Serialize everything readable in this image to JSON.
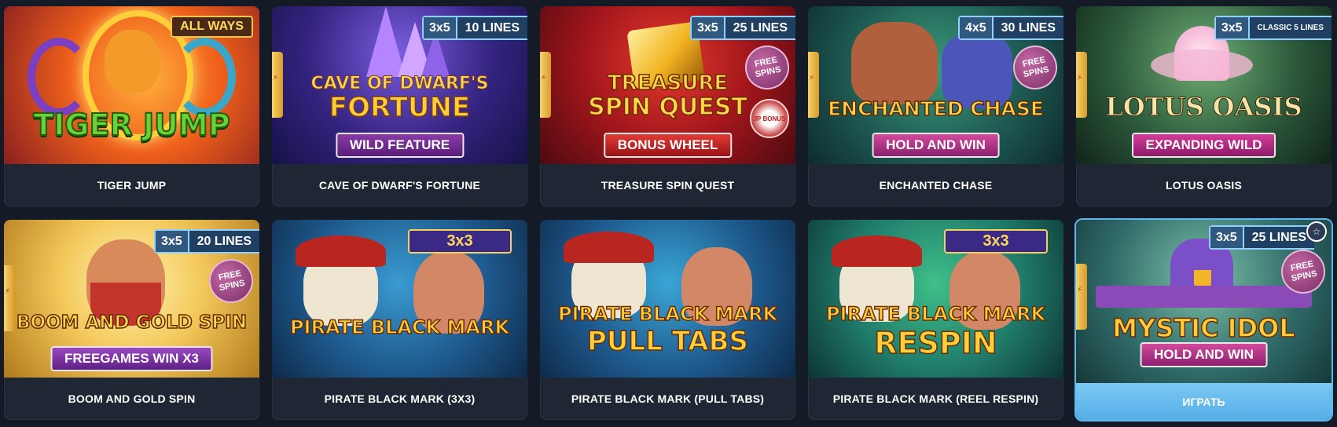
{
  "games": [
    {
      "caption": "TIGER JUMP",
      "badge_text": "ALL WAYS",
      "logo": "TIGER JUMP"
    },
    {
      "caption": "CAVE OF DWARF'S FORTUNE",
      "badge_format": "3x5",
      "badge_lines": "10 LINES",
      "logo_line1": "CAVE OF DWARF'S",
      "logo_line2": "FORTUNE",
      "feature": "WILD FEATURE"
    },
    {
      "caption": "TREASURE SPIN QUEST",
      "badge_format": "3x5",
      "badge_lines": "25 LINES",
      "free": "FREE SPINS",
      "jp": "JP BONUS",
      "logo_line1": "TREASURE",
      "logo_line2": "SPIN QUEST",
      "feature": "BONUS WHEEL"
    },
    {
      "caption": "ENCHANTED CHASE",
      "badge_format": "4x5",
      "badge_lines": "30 LINES",
      "free": "FREE SPINS",
      "logo": "ENCHANTED CHASE",
      "feature": "HOLD AND WIN"
    },
    {
      "caption": "LOTUS OASIS",
      "badge_format": "3x5",
      "badge_lines": "CLASSIC 5 LINES",
      "logo": "LOTUS OASIS",
      "feature": "EXPANDING WILD"
    },
    {
      "caption": "BOOM AND GOLD SPIN",
      "badge_format": "3x5",
      "badge_lines": "20 LINES",
      "free": "FREE SPINS",
      "logo": "BOOM AND GOLD SPIN",
      "feature": "FREEGAMES WIN X3"
    },
    {
      "caption": "PIRATE BLACK MARK (3X3)",
      "badge_text": "3x3",
      "logo": "PIRATE BLACK MARK"
    },
    {
      "caption": "PIRATE BLACK MARK (PULL TABS)",
      "logo_line1": "PIRATE BLACK MARK",
      "logo_line2": "PULL TABS"
    },
    {
      "caption": "PIRATE BLACK MARK (REEL RESPIN)",
      "badge_text": "3x3",
      "logo_line1": "PIRATE BLACK MARK",
      "logo_line2": "RESPIN"
    },
    {
      "badge_format": "3x5",
      "badge_lines": "25 LINES",
      "free": "FREE SPINS",
      "logo": "MYSTIC IDOL",
      "feature": "HOLD AND WIN",
      "play_label": "ИГРАТЬ"
    }
  ],
  "colors": {
    "background": "#141b27",
    "card": "#1f2735",
    "accent": "#5fb7ec"
  }
}
